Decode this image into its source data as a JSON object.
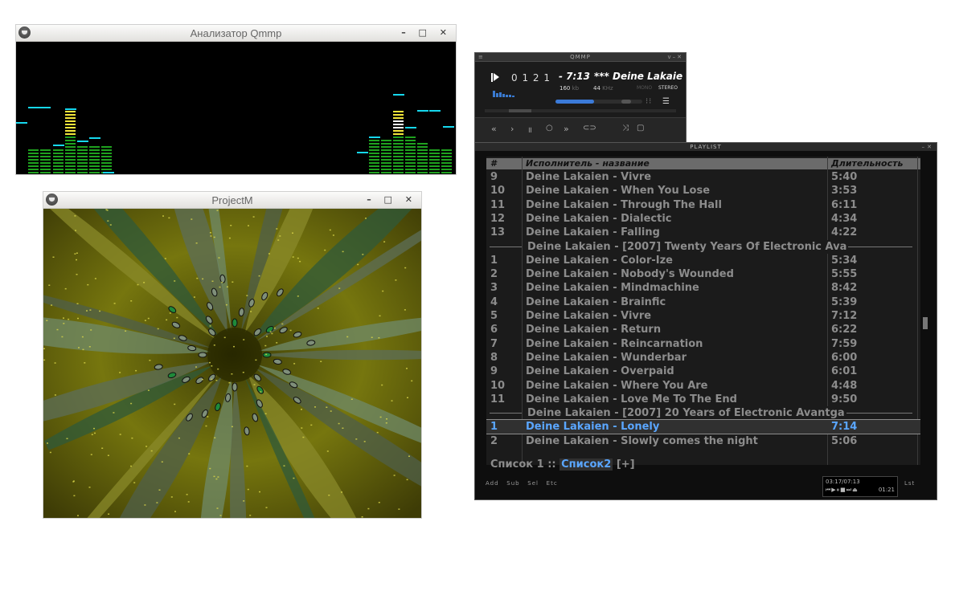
{
  "analyzer": {
    "title": "Анализатор Qmmp",
    "buttons": "– □ ✕"
  },
  "projectm": {
    "title": "ProjectM",
    "buttons": "– □ ✕"
  },
  "player": {
    "titlebar": "QMMP",
    "time_digits": "0 1 2 1",
    "remaining": "- 7:13",
    "track": "*** Deine Lakaien",
    "bitrate": "160",
    "bitrate_unit": "kb",
    "samplerate": "44",
    "samplerate_unit": "KHz",
    "mono": "MONO",
    "stereo": "STEREO",
    "progress_fraction": 0.63
  },
  "playlist": {
    "titlebar": "PLAYLIST",
    "header": {
      "num": "#",
      "title": "Исполнитель - название",
      "duration": "Длительность"
    },
    "rows": [
      {
        "type": "track",
        "n": "9",
        "title": "Deine Lakaien - Vivre",
        "d": "5:40"
      },
      {
        "type": "track",
        "n": "10",
        "title": "Deine Lakaien - When You Lose",
        "d": "3:53"
      },
      {
        "type": "track",
        "n": "11",
        "title": "Deine Lakaien - Through The Hall",
        "d": "6:11"
      },
      {
        "type": "track",
        "n": "12",
        "title": "Deine Lakaien - Dialectic",
        "d": "4:34"
      },
      {
        "type": "track",
        "n": "13",
        "title": "Deine Lakaien - Falling",
        "d": "4:22"
      },
      {
        "type": "group",
        "title": "Deine Lakaien - [2007] Twenty Years Of Electronic Ava"
      },
      {
        "type": "track",
        "n": "1",
        "title": "Deine Lakaien - Color-Ize",
        "d": "5:34"
      },
      {
        "type": "track",
        "n": "2",
        "title": "Deine Lakaien - Nobody's Wounded",
        "d": "5:55"
      },
      {
        "type": "track",
        "n": "3",
        "title": "Deine Lakaien - Mindmachine",
        "d": "8:42"
      },
      {
        "type": "track",
        "n": "4",
        "title": "Deine Lakaien - Brainfic",
        "d": "5:39"
      },
      {
        "type": "track",
        "n": "5",
        "title": "Deine Lakaien - Vivre",
        "d": "7:12"
      },
      {
        "type": "track",
        "n": "6",
        "title": "Deine Lakaien - Return",
        "d": "6:22"
      },
      {
        "type": "track",
        "n": "7",
        "title": "Deine Lakaien - Reincarnation",
        "d": "7:59"
      },
      {
        "type": "track",
        "n": "8",
        "title": "Deine Lakaien - Wunderbar",
        "d": "6:00"
      },
      {
        "type": "track",
        "n": "9",
        "title": "Deine Lakaien - Overpaid",
        "d": "6:01"
      },
      {
        "type": "track",
        "n": "10",
        "title": "Deine Lakaien - Where You Are",
        "d": "4:48"
      },
      {
        "type": "track",
        "n": "11",
        "title": "Deine Lakaien - Love Me To The End",
        "d": "9:50"
      },
      {
        "type": "group",
        "title": "Deine Lakaien - [2007] 20 Years of Electronic Avantga"
      },
      {
        "type": "track",
        "n": "1",
        "title": "Deine Lakaien - Lonely",
        "d": "7:14",
        "current": true
      },
      {
        "type": "track",
        "n": "2",
        "title": "Deine Lakaien - Slowly comes the night",
        "d": "5:06"
      }
    ],
    "tabs": {
      "tab1": "Список 1",
      "sep": "::",
      "tab2": "Список2",
      "add": "[+]"
    },
    "bottom": {
      "add": "Add",
      "sub": "Sub",
      "sel": "Sel",
      "etc": "Etc",
      "lst": "Lst"
    },
    "mini": {
      "time": "03:17/07:13",
      "elapsed": "01:21"
    }
  },
  "colors": {
    "accent": "#5aa6ff",
    "analyzer_green": "#1fa21f",
    "analyzer_yellow": "#f2e63a",
    "analyzer_peak": "#16d8ee"
  }
}
